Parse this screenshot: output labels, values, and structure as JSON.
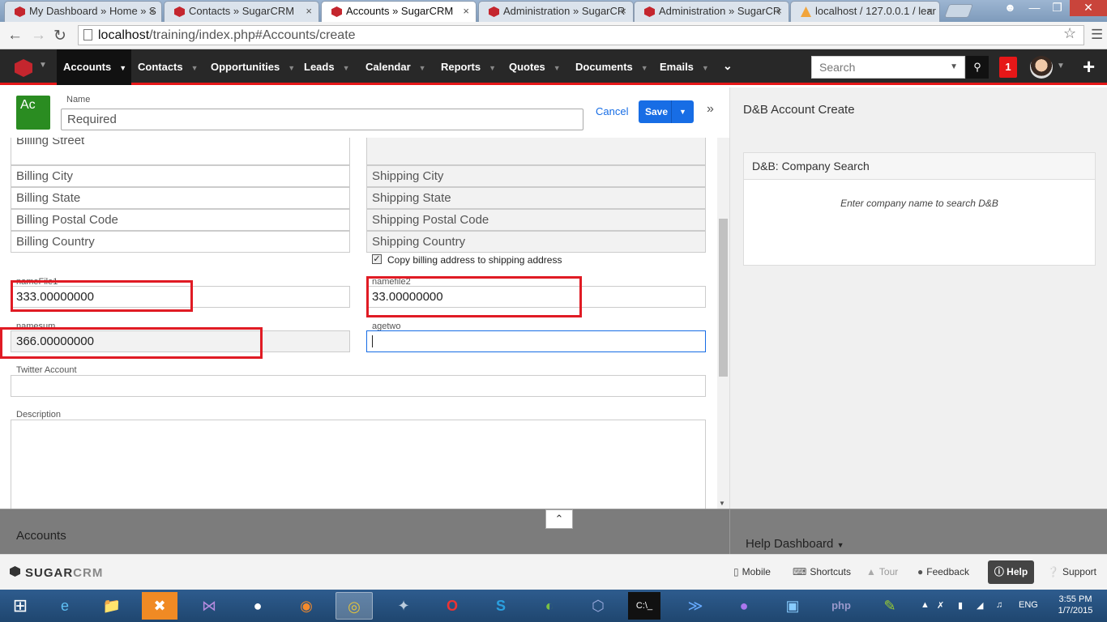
{
  "browser": {
    "tabs": [
      {
        "title": "My Dashboard » Home » S",
        "favicon": "sugarcrm-favicon"
      },
      {
        "title": "Contacts » SugarCRM",
        "favicon": "sugarcrm-favicon"
      },
      {
        "title": "Accounts » SugarCRM",
        "favicon": "sugarcrm-favicon",
        "active": true
      },
      {
        "title": "Administration » SugarCR",
        "favicon": "sugarcrm-favicon"
      },
      {
        "title": "Administration » SugarCR",
        "favicon": "sugarcrm-favicon"
      },
      {
        "title": "localhost / 127.0.0.1 / lear",
        "favicon": "phpmyadmin-favicon"
      }
    ],
    "tab_close": "×",
    "url_host": "localhost",
    "url_path": "/training/index.php#Accounts/create"
  },
  "nav": {
    "items": [
      "Accounts",
      "Contacts",
      "Opportunities",
      "Leads",
      "Calendar",
      "Reports",
      "Quotes",
      "Documents",
      "Emails"
    ],
    "active": "Accounts",
    "search_placeholder": "Search",
    "notification_count": "1"
  },
  "record": {
    "module_abbr": "Ac",
    "name_label": "Name",
    "name_placeholder": "Required",
    "cancel_label": "Cancel",
    "save_label": "Save"
  },
  "form": {
    "billing_street": "Billing Street",
    "billing_city": "Billing City",
    "billing_state": "Billing State",
    "billing_postal": "Billing Postal Code",
    "billing_country": "Billing Country",
    "shipping_city": "Shipping City",
    "shipping_state": "Shipping State",
    "shipping_postal": "Shipping Postal Code",
    "shipping_country": "Shipping Country",
    "copy_label": "Copy billing address to shipping address",
    "namefile1_label": "nameFile1",
    "namefile1_value": "333.00000000",
    "namefile2_label": "namefile2",
    "namefile2_value": "33.00000000",
    "namesum_label": "namesum",
    "namesum_value": "366.00000000",
    "agetwo_label": "agetwo",
    "agetwo_value": "",
    "twitter_label": "Twitter Account",
    "description_label": "Description"
  },
  "sidepanel": {
    "title": "D&B Account Create",
    "panel_title": "D&B: Company Search",
    "hint": "Enter company name to search D&B"
  },
  "footer": {
    "module": "Accounts",
    "help_dashboard": "Help Dashboard",
    "brand_sugar": "SUGAR",
    "brand_crm": "CRM",
    "buttons": {
      "mobile": "Mobile",
      "shortcuts": "Shortcuts",
      "tour": "Tour",
      "feedback": "Feedback",
      "help": "Help",
      "support": "Support"
    }
  },
  "taskbar": {
    "language": "ENG",
    "time": "3:55 PM",
    "date": "1/7/2015"
  },
  "colors": {
    "accent": "#176de5",
    "nav_bg": "#282828",
    "nav_underline": "#e61718",
    "module_icon": "#2a8c21",
    "highlight": "#e01b24"
  }
}
